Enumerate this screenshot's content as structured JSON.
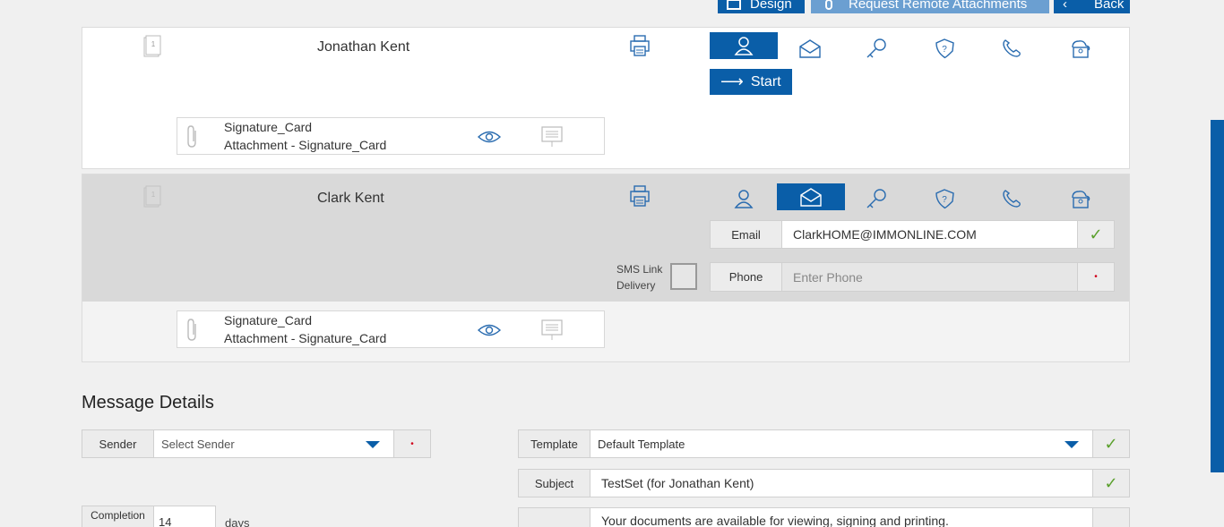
{
  "toolbar": {
    "design_label": "Design",
    "request_label": "Request Remote Attachments",
    "back_label": "Back"
  },
  "signers": [
    {
      "name": "Jonathan Kent",
      "start_label": "Start",
      "attachment": {
        "title": "Signature_Card",
        "subtitle": "Attachment - Signature_Card"
      }
    },
    {
      "name": "Clark Kent",
      "sms_label_1": "SMS Link",
      "sms_label_2": "Delivery",
      "email_label": "Email",
      "email_value": "ClarkHOME@IMMONLINE.COM",
      "phone_label": "Phone",
      "phone_placeholder": "Enter Phone",
      "attachment": {
        "title": "Signature_Card",
        "subtitle": "Attachment - Signature_Card"
      }
    }
  ],
  "message": {
    "heading": "Message Details",
    "sender_label": "Sender",
    "sender_placeholder": "Select Sender",
    "template_label": "Template",
    "template_value": "Default Template",
    "subject_label": "Subject",
    "subject_value": "TestSet (for Jonathan Kent)",
    "body_value": "Your documents are available for viewing, signing and printing.",
    "completion_label": "Completion",
    "completion_value": "14",
    "days_label": "days"
  },
  "colors": {
    "primary": "#0a5ea8",
    "primary_light": "#6b9fd1",
    "check": "#5aa02c",
    "required": "#d0021b"
  }
}
